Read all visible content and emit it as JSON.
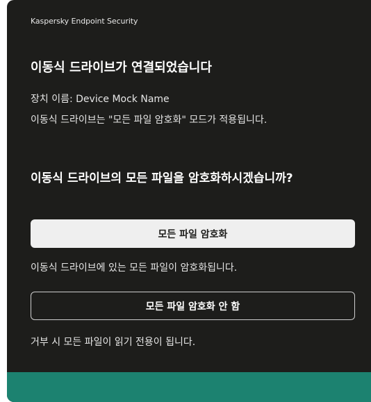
{
  "window": {
    "app_title": "Kaspersky Endpoint Security"
  },
  "dialog": {
    "heading": "이동식 드라이브가 연결되었습니다",
    "device_name": "장치 이름: Device Mock Name",
    "mode_text": "이동식 드라이브는 \"모든 파일 암호화\" 모드가 적용됩니다.",
    "question": "이동식 드라이브의 모든 파일을 암호화하시겠습니까?",
    "encrypt_button_label": "모든 파일 암호화",
    "encrypt_hint": "이동식 드라이브에 있는 모든 파일이 암호화됩니다.",
    "skip_button_label": "모든 파일 암호화 안 함",
    "skip_hint": "거부 시 모든 파일이 읽기 전용이 됩니다."
  },
  "colors": {
    "background": "#1d1d1b",
    "primary_button": "#efefef",
    "accent_bar": "#1c8270"
  }
}
